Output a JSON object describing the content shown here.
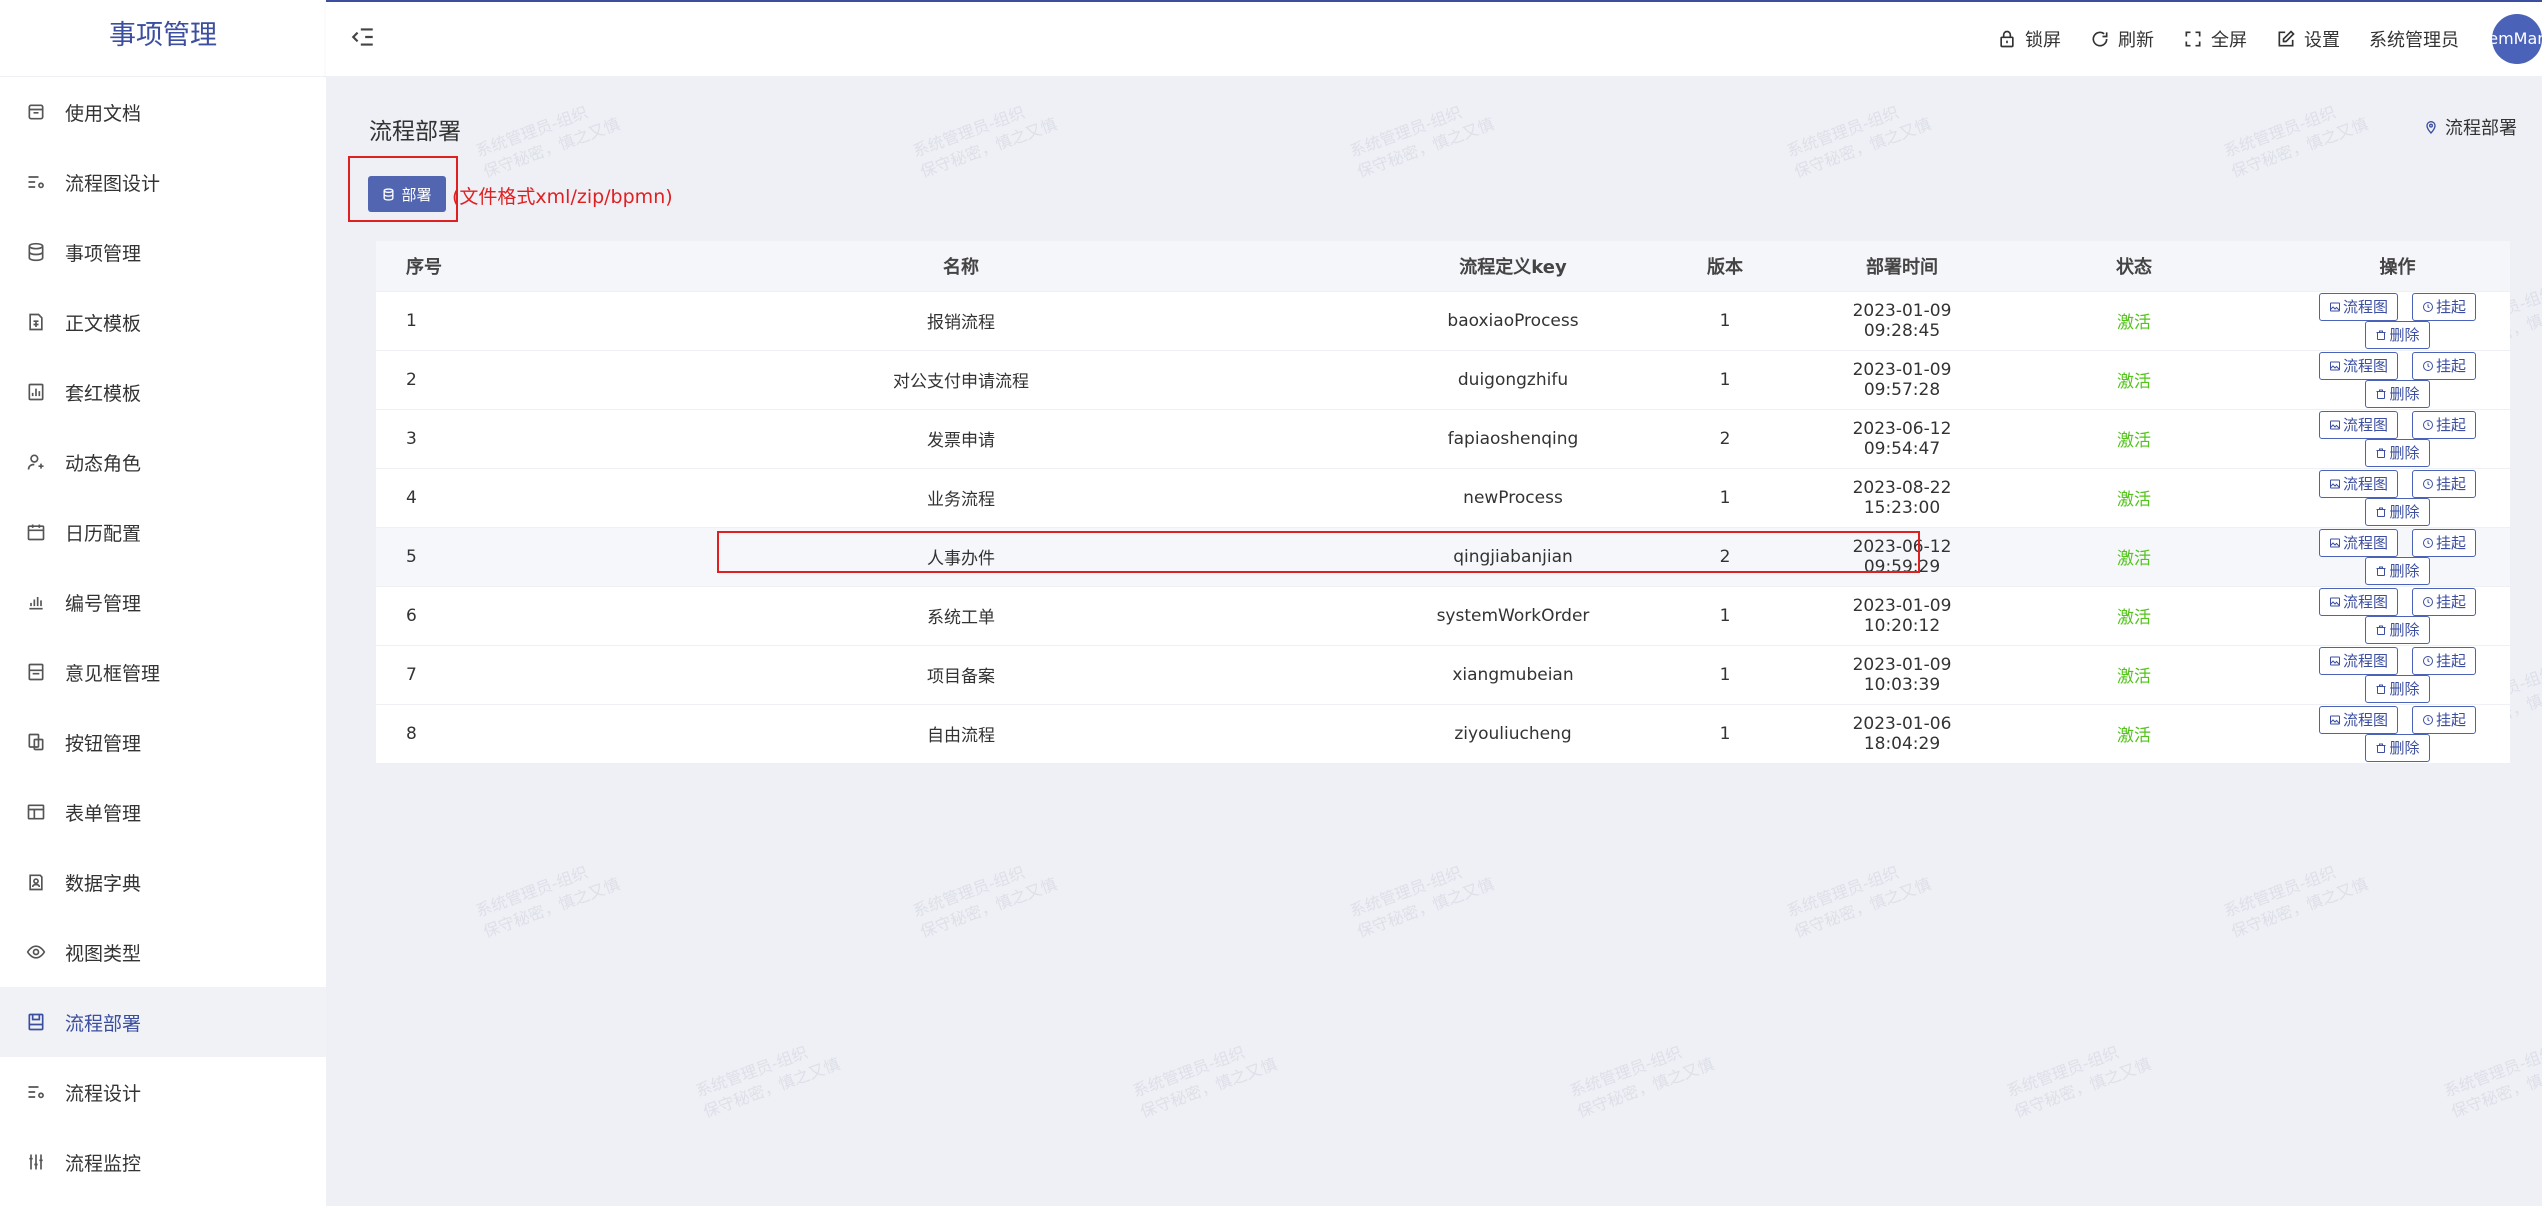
{
  "app": {
    "title": "事项管理"
  },
  "sidebar": {
    "items": [
      {
        "label": "使用文档",
        "icon": "document-box-icon"
      },
      {
        "label": "流程图设计",
        "icon": "list-settings-icon"
      },
      {
        "label": "事项管理",
        "icon": "database-icon"
      },
      {
        "label": "正文模板",
        "icon": "text-file-icon"
      },
      {
        "label": "套红模板",
        "icon": "template-chart-icon"
      },
      {
        "label": "动态角色",
        "icon": "user-plus-icon"
      },
      {
        "label": "日历配置",
        "icon": "calendar-icon"
      },
      {
        "label": "编号管理",
        "icon": "bar-chart-icon"
      },
      {
        "label": "意见框管理",
        "icon": "form-box-icon"
      },
      {
        "label": "按钮管理",
        "icon": "copy-icon"
      },
      {
        "label": "表单管理",
        "icon": "table-icon"
      },
      {
        "label": "数据字典",
        "icon": "dictionary-icon"
      },
      {
        "label": "视图类型",
        "icon": "eye-icon"
      },
      {
        "label": "流程部署",
        "icon": "save-box-icon",
        "active": true
      },
      {
        "label": "流程设计",
        "icon": "list-settings-icon"
      },
      {
        "label": "流程监控",
        "icon": "sliders-icon"
      }
    ]
  },
  "header": {
    "lock": "锁屏",
    "refresh": "刷新",
    "fullscreen": "全屏",
    "settings": "设置",
    "user_name": "系统管理员",
    "avatar_text": "SystemManager"
  },
  "page": {
    "title": "流程部署",
    "breadcrumb": "流程部署",
    "deploy_button": "部署",
    "deploy_hint": "(文件格式xml/zip/bpmn)"
  },
  "table": {
    "columns": [
      "序号",
      "名称",
      "流程定义key",
      "版本",
      "部署时间",
      "状态",
      "操作"
    ],
    "actions": [
      "流程图",
      "挂起",
      "删除"
    ],
    "rows": [
      {
        "idx": "1",
        "name": "报销流程",
        "key": "baoxiaoProcess",
        "version": "1",
        "time": "2023-01-09 09:28:45",
        "state": "激活"
      },
      {
        "idx": "2",
        "name": "对公支付申请流程",
        "key": "duigongzhifu",
        "version": "1",
        "time": "2023-01-09 09:57:28",
        "state": "激活"
      },
      {
        "idx": "3",
        "name": "发票申请",
        "key": "fapiaoshenqing",
        "version": "2",
        "time": "2023-06-12 09:54:47",
        "state": "激活"
      },
      {
        "idx": "4",
        "name": "业务流程",
        "key": "newProcess",
        "version": "1",
        "time": "2023-08-22 15:23:00",
        "state": "激活"
      },
      {
        "idx": "5",
        "name": "人事办件",
        "key": "qingjiabanjian",
        "version": "2",
        "time": "2023-06-12 09:59:29",
        "state": "激活"
      },
      {
        "idx": "6",
        "name": "系统工单",
        "key": "systemWorkOrder",
        "version": "1",
        "time": "2023-01-09 10:20:12",
        "state": "激活"
      },
      {
        "idx": "7",
        "name": "项目备案",
        "key": "xiangmubeian",
        "version": "1",
        "time": "2023-01-09 10:03:39",
        "state": "激活"
      },
      {
        "idx": "8",
        "name": "自由流程",
        "key": "ziyouliucheng",
        "version": "1",
        "time": "2023-01-06 18:04:29",
        "state": "激活"
      }
    ]
  },
  "watermark": {
    "line1": "系统管理员-组织",
    "line2": "保守秘密，慎之又慎"
  }
}
